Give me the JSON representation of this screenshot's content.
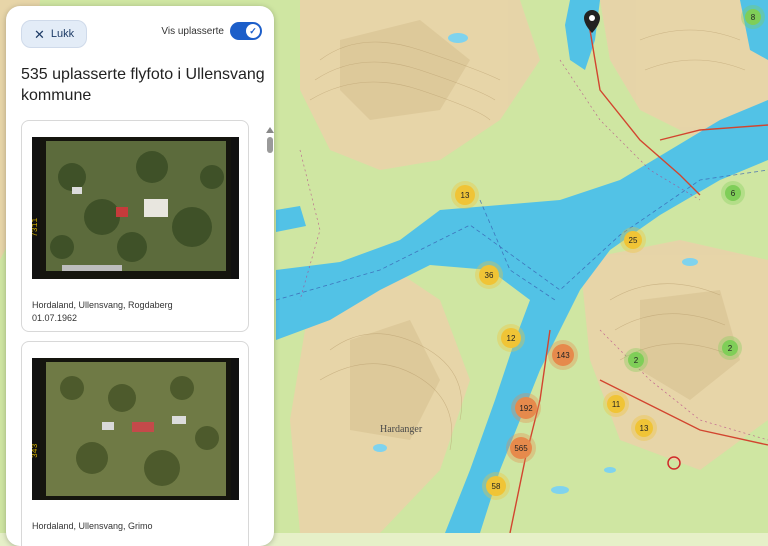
{
  "panel": {
    "close_label": "Lukk",
    "toggle_label": "Vis uplasserte",
    "heading": "535 uplasserte flyfoto i Ullensvang kommune",
    "cards": [
      {
        "location": "Hordaland, Ullensvang, Rogdaberg",
        "date": "01.07.1962",
        "frame_code": "7311"
      },
      {
        "location": "Hordaland, Ullensvang, Grimo",
        "date": "",
        "frame_code": "343"
      }
    ]
  },
  "map": {
    "clusters": [
      {
        "label": "13",
        "color": "yellow"
      },
      {
        "label": "36",
        "color": "yellow"
      },
      {
        "label": "12",
        "color": "yellow"
      },
      {
        "label": "143",
        "color": "orange"
      },
      {
        "label": "192",
        "color": "orange"
      },
      {
        "label": "565",
        "color": "orange"
      },
      {
        "label": "58",
        "color": "yellow"
      },
      {
        "label": "11",
        "color": "yellow"
      },
      {
        "label": "13",
        "color": "yellow"
      },
      {
        "label": "25",
        "color": "yellow"
      },
      {
        "label": "6",
        "color": "green"
      },
      {
        "label": "8",
        "color": "green"
      },
      {
        "label": "2",
        "color": "green"
      },
      {
        "label": "2",
        "color": "green"
      }
    ],
    "place_label": "Hardanger",
    "colors": {
      "water": "#4fc4e8",
      "lowland": "#c9e39a",
      "highland": "#e9d3a8",
      "road": "#d2452f"
    }
  }
}
